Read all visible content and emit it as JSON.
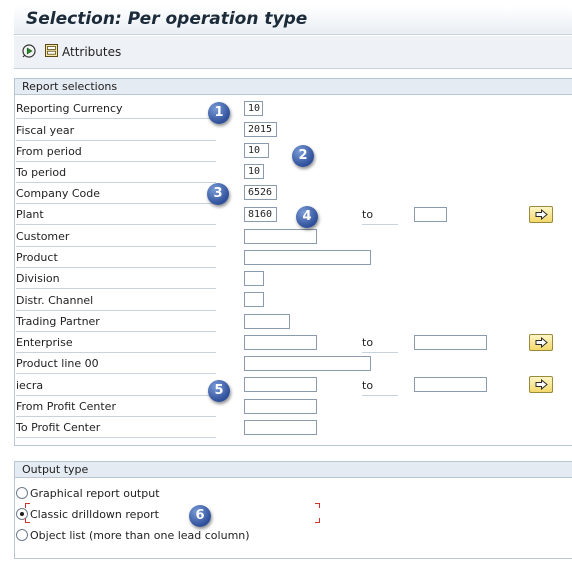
{
  "window": {
    "title": "Selection: Per operation type"
  },
  "toolbar": {
    "execute_icon": "execute-icon",
    "attributes_icon": "attributes-icon",
    "attributes_label": "Attributes"
  },
  "report_selections": {
    "header": "Report selections",
    "to_label": "to",
    "fields": [
      {
        "label": "Reporting Currency",
        "value": "10"
      },
      {
        "label": "Fiscal year",
        "value": "2015"
      },
      {
        "label": "From period",
        "value": "10"
      },
      {
        "label": "To period",
        "value": "10"
      },
      {
        "label": "Company Code",
        "value": "6526"
      },
      {
        "label": "Plant",
        "value": "8160",
        "to_value": ""
      },
      {
        "label": "Customer",
        "value": ""
      },
      {
        "label": "Product",
        "value": ""
      },
      {
        "label": "Division",
        "value": ""
      },
      {
        "label": "Distr. Channel",
        "value": ""
      },
      {
        "label": "Trading Partner",
        "value": ""
      },
      {
        "label": "Enterprise",
        "value": "",
        "to_value": ""
      },
      {
        "label": "Product line 00",
        "value": ""
      },
      {
        "label": "iecra",
        "value": "",
        "to_value": ""
      },
      {
        "label": "From Profit Center",
        "value": ""
      },
      {
        "label": "To Profit Center",
        "value": ""
      }
    ]
  },
  "output_type": {
    "header": "Output type",
    "options": [
      {
        "label": "Graphical report output",
        "selected": false
      },
      {
        "label": "Classic drilldown report",
        "selected": true
      },
      {
        "label": "Object list (more than one lead column)",
        "selected": false
      }
    ]
  },
  "callouts": [
    "1",
    "2",
    "3",
    "4",
    "5",
    "6"
  ],
  "colors": {
    "group_header_bg": "#e4ebf2",
    "badge_blue": "#2e4f9a",
    "arrow_button_yellow": "#f3d86a",
    "focus_corner_red": "#d0342c"
  }
}
